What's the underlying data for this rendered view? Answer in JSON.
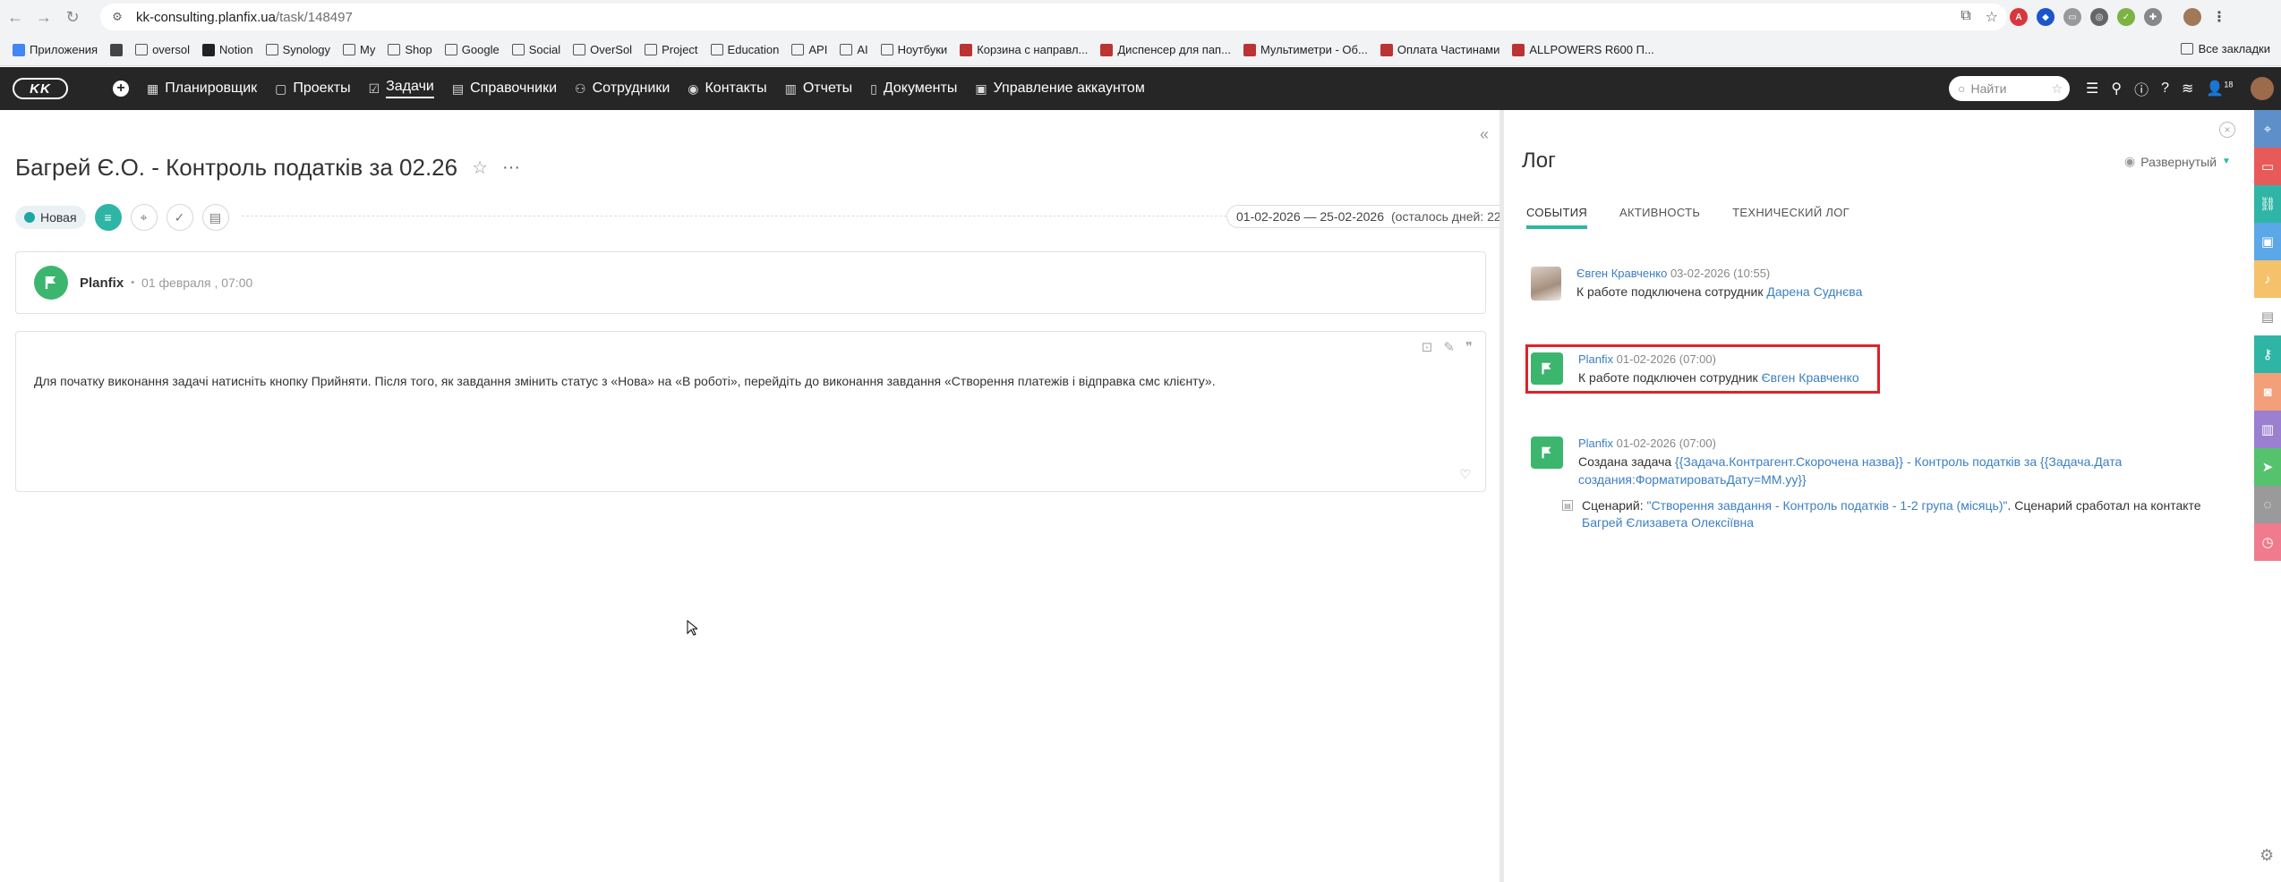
{
  "browser": {
    "url_domain": "kk-consulting.planfix.ua",
    "url_path": "/task/148497",
    "bookmarks": [
      {
        "label": "Приложения",
        "icon": "apps-icon"
      },
      {
        "label": "",
        "icon": "grid-icon"
      },
      {
        "label": "oversol",
        "icon": "folder-icon"
      },
      {
        "label": "Notion",
        "icon": "notion-icon"
      },
      {
        "label": "Synology",
        "icon": "folder-icon"
      },
      {
        "label": "My",
        "icon": "folder-icon"
      },
      {
        "label": "Shop",
        "icon": "folder-icon"
      },
      {
        "label": "Google",
        "icon": "folder-icon"
      },
      {
        "label": "Social",
        "icon": "folder-icon"
      },
      {
        "label": "OverSol",
        "icon": "folder-icon"
      },
      {
        "label": "Project",
        "icon": "folder-icon"
      },
      {
        "label": "Education",
        "icon": "folder-icon"
      },
      {
        "label": "API",
        "icon": "folder-icon"
      },
      {
        "label": "AI",
        "icon": "folder-icon"
      },
      {
        "label": "Ноутбуки",
        "icon": "folder-icon"
      },
      {
        "label": "Корзина с направл...",
        "icon": "site-icon"
      },
      {
        "label": "Диспенсер для пап...",
        "icon": "site-icon"
      },
      {
        "label": "Мультиметри - Об...",
        "icon": "site-icon"
      },
      {
        "label": "Оплата Частинами",
        "icon": "site-icon"
      },
      {
        "label": "ALLPOWERS R600 П...",
        "icon": "site-icon"
      }
    ],
    "all_bookmarks": "Все закладки"
  },
  "appbar": {
    "logo": "KK",
    "menu": [
      {
        "label": "Планировщик",
        "icon": "calendar-icon"
      },
      {
        "label": "Проекты",
        "icon": "folder-icon"
      },
      {
        "label": "Задачи",
        "icon": "check-square-icon",
        "active": true
      },
      {
        "label": "Справочники",
        "icon": "book-icon"
      },
      {
        "label": "Сотрудники",
        "icon": "people-icon"
      },
      {
        "label": "Контакты",
        "icon": "contact-icon"
      },
      {
        "label": "Отчеты",
        "icon": "chart-icon"
      },
      {
        "label": "Документы",
        "icon": "document-icon"
      },
      {
        "label": "Управление аккаунтом",
        "icon": "account-icon"
      }
    ],
    "search_placeholder": "Найти",
    "notifications_count": "18"
  },
  "task": {
    "title": "Багрей Є.О. - Контроль податків за 02.26",
    "status": "Новая",
    "dates": "01-02-2026 — 25-02-2026",
    "remaining": "(осталось дней: 22)",
    "author": "Planfix",
    "author_date": "01 февраля , 07:00",
    "description": "Для початку виконання задачі натисніть кнопку Прийняти. Після того, як завдання змінить статус з «Нова» на «В роботі», перейдіть до виконання завдання «Створення платежів і відправка смс клієнту»."
  },
  "log": {
    "title": "Лог",
    "view_mode": "Развернутый",
    "tabs": [
      "СОБЫТИЯ",
      "АКТИВНОСТЬ",
      "ТЕХНИЧЕСКИЙ ЛОГ"
    ],
    "entries": [
      {
        "author": "Євген Кравченко",
        "date": "03-02-2026 (10:55)",
        "text": "К работе подключена сотрудник ",
        "link": "Дарена Суднєва"
      },
      {
        "author": "Planfix",
        "date": "01-02-2026 (07:00)",
        "text": "К работе подключен сотрудник ",
        "link": "Євген Кравченко"
      },
      {
        "author": "Planfix",
        "date": "01-02-2026 (07:00)",
        "text": "Создана задача ",
        "link": "{{Задача.Контрагент.Скорочена назва}} - Контроль податків за {{Задача.Дата",
        "link2": "создания:ФорматироватьДату=ММ.уу}}"
      }
    ],
    "scenario_label": "Сценарий: ",
    "scenario_link": "\"Створення завдання - Контроль податків - 1-2 група (місяць)\"",
    "scenario_text": ". Сценарий сработал на контакте",
    "scenario_contact": "Багрей Єлизавета Олексіївна"
  },
  "colors": {
    "accent": "#2fb5a5",
    "link": "#3b7fc4",
    "highlight": "#e0212a",
    "appbar": "#262626"
  }
}
